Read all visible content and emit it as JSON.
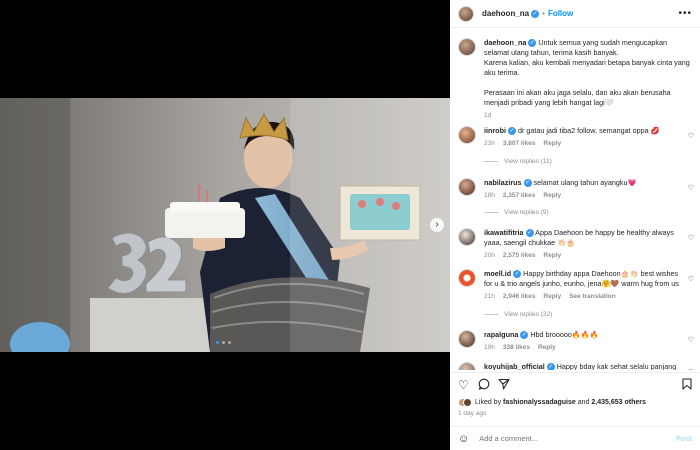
{
  "post": {
    "username": "daehoon_na",
    "follow_label": "Follow",
    "separator": "•",
    "more_label": "•••",
    "caption_line1": "Untuk semua yang sudah mengucapkan selamat ulang tahun, terima kasih banyak.",
    "caption_line2": "Karena kalian, aku kembali menyadari betapa banyak cinta yang aku terima.",
    "caption_line3": "Perasaan ini akan aku jaga selalu, dan aku akan berusaha menjadi pribadi yang lebih hangat lagi🤍",
    "caption_time": "1d"
  },
  "comments": [
    {
      "user": "iinrobi",
      "text": "dr gatau jadi tiba2 follow, semangat oppa 💋",
      "time": "23h",
      "likes": "3,807 likes",
      "reply": "Reply",
      "replies": "View replies (11)"
    },
    {
      "user": "nabilazirus",
      "text": "selamat ulang tahun ayangku💗",
      "time": "18h",
      "likes": "2,357 likes",
      "reply": "Reply",
      "replies": "View replies (9)"
    },
    {
      "user": "ikawatifitria",
      "text": "Appa Daehoon be happy be healthy always yaaa, saengil chukkae 👏🏻🎂",
      "time": "20h",
      "likes": "2,575 likes",
      "reply": "Reply",
      "replies": ""
    },
    {
      "user": "moell.id",
      "text": "Happy birthday appa Daehoon🎂👏🏻 best wishes for u & trio angels junho, eunho, jena🤗🤎 warm hug from us",
      "time": "21h",
      "likes": "2,946 likes",
      "reply": "Reply",
      "translate": "See translation",
      "replies": "View replies (32)"
    },
    {
      "user": "rapalguna",
      "text": "Hbd brooooo🔥🔥🔥",
      "time": "19h",
      "likes": "338 likes",
      "reply": "Reply",
      "replies": ""
    },
    {
      "user": "koyuhijab_official",
      "text": "Happy bday kak sehat selalu panjang",
      "time": "",
      "likes": "",
      "reply": "",
      "replies": ""
    }
  ],
  "footer": {
    "liked_by_prefix": "Liked by",
    "liked_by_user": "fashionalyssadaguise",
    "liked_by_and": "and",
    "liked_by_count": "2,435,653 others",
    "time_ago": "1 day ago",
    "add_comment_placeholder": "Add a comment...",
    "post_label": "Post"
  },
  "icons": {
    "like": "heart-icon",
    "comment": "comment-icon",
    "share": "share-icon",
    "save": "bookmark-icon",
    "emoji": "emoji-icon",
    "next": "chevron-right-icon"
  },
  "colors": {
    "accent": "#0095f6",
    "verified": "#3897f0",
    "muted": "#8e8e8e"
  },
  "carousel": {
    "count": 3,
    "active": 1
  }
}
